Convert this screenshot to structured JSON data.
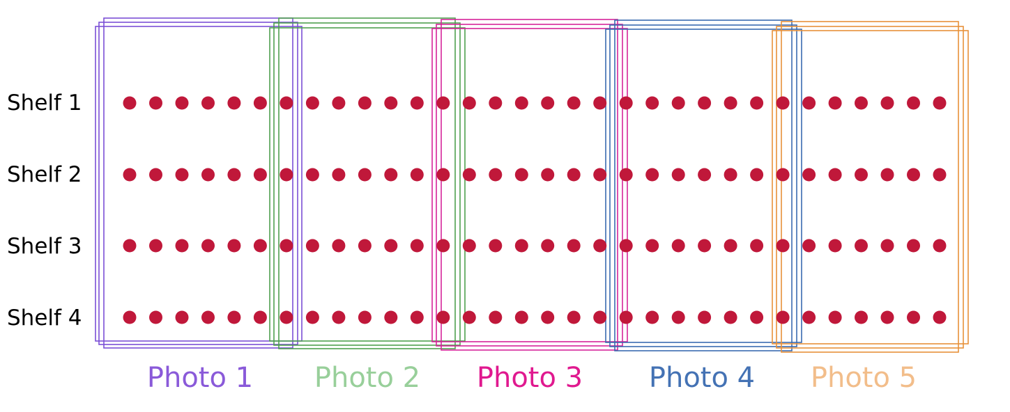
{
  "diagram": {
    "shelves": [
      {
        "label": "Shelf 1"
      },
      {
        "label": "Shelf 2"
      },
      {
        "label": "Shelf 3"
      },
      {
        "label": "Shelf 4"
      }
    ],
    "items_per_shelf": 32,
    "item_color": "#c0183a",
    "photos": [
      {
        "label": "Photo 1",
        "box_color": "#7b4fd6",
        "label_color": "#8a5ad9"
      },
      {
        "label": "Photo 2",
        "box_color": "#4fa04f",
        "label_color": "#98cf9a"
      },
      {
        "label": "Photo 3",
        "box_color": "#d6249a",
        "label_color": "#e0198f"
      },
      {
        "label": "Photo 4",
        "box_color": "#3a6ab0",
        "label_color": "#4472b4"
      },
      {
        "label": "Photo 5",
        "box_color": "#e8913a",
        "label_color": "#f2bd8a"
      }
    ],
    "frames_per_photo": 3
  }
}
